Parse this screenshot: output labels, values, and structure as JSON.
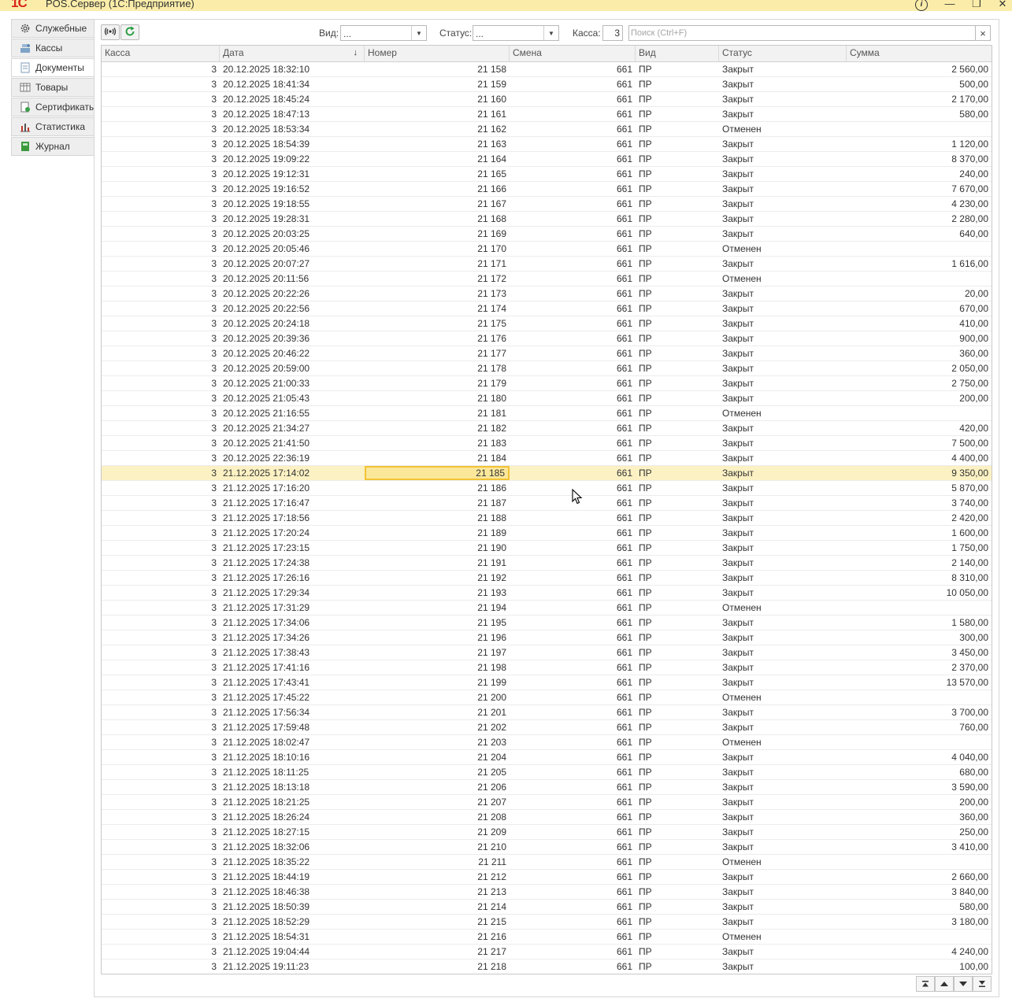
{
  "window": {
    "logo": "1С",
    "title": "POS.Сервер  (1С:Предприятие)",
    "info_glyph": "i",
    "minimize_glyph": "—",
    "maximize_glyph": "❐",
    "close_glyph": "✕"
  },
  "sidebar": {
    "items": [
      {
        "label": "Служебные",
        "icon": "gear-icon"
      },
      {
        "label": "Кассы",
        "icon": "cash-register-icon"
      },
      {
        "label": "Документы",
        "icon": "document-icon",
        "active": true
      },
      {
        "label": "Товары",
        "icon": "table-icon"
      },
      {
        "label": "Сертификаты",
        "icon": "certificate-icon"
      },
      {
        "label": "Статистика",
        "icon": "chart-icon"
      },
      {
        "label": "Журнал",
        "icon": "journal-icon"
      }
    ]
  },
  "toolbar": {
    "vid_label": "Вид:",
    "vid_value": "...",
    "status_label": "Статус:",
    "status_value": "...",
    "kassa_label": "Касса:",
    "kassa_value": "3",
    "search_placeholder": "Поиск (Ctrl+F)",
    "clear_glyph": "×"
  },
  "table": {
    "columns": [
      "Касса",
      "Дата",
      "Номер",
      "Смена",
      "Вид",
      "Статус",
      "Сумма"
    ],
    "sort_indicator": "↓",
    "selected_index": 27,
    "rows": [
      [
        "3",
        "20.12.2025 18:32:10",
        "21 158",
        "661",
        "ПР",
        "Закрыт",
        "2 560,00"
      ],
      [
        "3",
        "20.12.2025 18:41:34",
        "21 159",
        "661",
        "ПР",
        "Закрыт",
        "500,00"
      ],
      [
        "3",
        "20.12.2025 18:45:24",
        "21 160",
        "661",
        "ПР",
        "Закрыт",
        "2 170,00"
      ],
      [
        "3",
        "20.12.2025 18:47:13",
        "21 161",
        "661",
        "ПР",
        "Закрыт",
        "580,00"
      ],
      [
        "3",
        "20.12.2025 18:53:34",
        "21 162",
        "661",
        "ПР",
        "Отменен",
        ""
      ],
      [
        "3",
        "20.12.2025 18:54:39",
        "21 163",
        "661",
        "ПР",
        "Закрыт",
        "1 120,00"
      ],
      [
        "3",
        "20.12.2025 19:09:22",
        "21 164",
        "661",
        "ПР",
        "Закрыт",
        "8 370,00"
      ],
      [
        "3",
        "20.12.2025 19:12:31",
        "21 165",
        "661",
        "ПР",
        "Закрыт",
        "240,00"
      ],
      [
        "3",
        "20.12.2025 19:16:52",
        "21 166",
        "661",
        "ПР",
        "Закрыт",
        "7 670,00"
      ],
      [
        "3",
        "20.12.2025 19:18:55",
        "21 167",
        "661",
        "ПР",
        "Закрыт",
        "4 230,00"
      ],
      [
        "3",
        "20.12.2025 19:28:31",
        "21 168",
        "661",
        "ПР",
        "Закрыт",
        "2 280,00"
      ],
      [
        "3",
        "20.12.2025 20:03:25",
        "21 169",
        "661",
        "ПР",
        "Закрыт",
        "640,00"
      ],
      [
        "3",
        "20.12.2025 20:05:46",
        "21 170",
        "661",
        "ПР",
        "Отменен",
        ""
      ],
      [
        "3",
        "20.12.2025 20:07:27",
        "21 171",
        "661",
        "ПР",
        "Закрыт",
        "1 616,00"
      ],
      [
        "3",
        "20.12.2025 20:11:56",
        "21 172",
        "661",
        "ПР",
        "Отменен",
        ""
      ],
      [
        "3",
        "20.12.2025 20:22:26",
        "21 173",
        "661",
        "ПР",
        "Закрыт",
        "20,00"
      ],
      [
        "3",
        "20.12.2025 20:22:56",
        "21 174",
        "661",
        "ПР",
        "Закрыт",
        "670,00"
      ],
      [
        "3",
        "20.12.2025 20:24:18",
        "21 175",
        "661",
        "ПР",
        "Закрыт",
        "410,00"
      ],
      [
        "3",
        "20.12.2025 20:39:36",
        "21 176",
        "661",
        "ПР",
        "Закрыт",
        "900,00"
      ],
      [
        "3",
        "20.12.2025 20:46:22",
        "21 177",
        "661",
        "ПР",
        "Закрыт",
        "360,00"
      ],
      [
        "3",
        "20.12.2025 20:59:00",
        "21 178",
        "661",
        "ПР",
        "Закрыт",
        "2 050,00"
      ],
      [
        "3",
        "20.12.2025 21:00:33",
        "21 179",
        "661",
        "ПР",
        "Закрыт",
        "2 750,00"
      ],
      [
        "3",
        "20.12.2025 21:05:43",
        "21 180",
        "661",
        "ПР",
        "Закрыт",
        "200,00"
      ],
      [
        "3",
        "20.12.2025 21:16:55",
        "21 181",
        "661",
        "ПР",
        "Отменен",
        ""
      ],
      [
        "3",
        "20.12.2025 21:34:27",
        "21 182",
        "661",
        "ПР",
        "Закрыт",
        "420,00"
      ],
      [
        "3",
        "20.12.2025 21:41:50",
        "21 183",
        "661",
        "ПР",
        "Закрыт",
        "7 500,00"
      ],
      [
        "3",
        "20.12.2025 22:36:19",
        "21 184",
        "661",
        "ПР",
        "Закрыт",
        "4 400,00"
      ],
      [
        "3",
        "21.12.2025 17:14:02",
        "21 185",
        "661",
        "ПР",
        "Закрыт",
        "9 350,00"
      ],
      [
        "3",
        "21.12.2025 17:16:20",
        "21 186",
        "661",
        "ПР",
        "Закрыт",
        "5 870,00"
      ],
      [
        "3",
        "21.12.2025 17:16:47",
        "21 187",
        "661",
        "ПР",
        "Закрыт",
        "3 740,00"
      ],
      [
        "3",
        "21.12.2025 17:18:56",
        "21 188",
        "661",
        "ПР",
        "Закрыт",
        "2 420,00"
      ],
      [
        "3",
        "21.12.2025 17:20:24",
        "21 189",
        "661",
        "ПР",
        "Закрыт",
        "1 600,00"
      ],
      [
        "3",
        "21.12.2025 17:23:15",
        "21 190",
        "661",
        "ПР",
        "Закрыт",
        "1 750,00"
      ],
      [
        "3",
        "21.12.2025 17:24:38",
        "21 191",
        "661",
        "ПР",
        "Закрыт",
        "2 140,00"
      ],
      [
        "3",
        "21.12.2025 17:26:16",
        "21 192",
        "661",
        "ПР",
        "Закрыт",
        "8 310,00"
      ],
      [
        "3",
        "21.12.2025 17:29:34",
        "21 193",
        "661",
        "ПР",
        "Закрыт",
        "10 050,00"
      ],
      [
        "3",
        "21.12.2025 17:31:29",
        "21 194",
        "661",
        "ПР",
        "Отменен",
        ""
      ],
      [
        "3",
        "21.12.2025 17:34:06",
        "21 195",
        "661",
        "ПР",
        "Закрыт",
        "1 580,00"
      ],
      [
        "3",
        "21.12.2025 17:34:26",
        "21 196",
        "661",
        "ПР",
        "Закрыт",
        "300,00"
      ],
      [
        "3",
        "21.12.2025 17:38:43",
        "21 197",
        "661",
        "ПР",
        "Закрыт",
        "3 450,00"
      ],
      [
        "3",
        "21.12.2025 17:41:16",
        "21 198",
        "661",
        "ПР",
        "Закрыт",
        "2 370,00"
      ],
      [
        "3",
        "21.12.2025 17:43:41",
        "21 199",
        "661",
        "ПР",
        "Закрыт",
        "13 570,00"
      ],
      [
        "3",
        "21.12.2025 17:45:22",
        "21 200",
        "661",
        "ПР",
        "Отменен",
        ""
      ],
      [
        "3",
        "21.12.2025 17:56:34",
        "21 201",
        "661",
        "ПР",
        "Закрыт",
        "3 700,00"
      ],
      [
        "3",
        "21.12.2025 17:59:48",
        "21 202",
        "661",
        "ПР",
        "Закрыт",
        "760,00"
      ],
      [
        "3",
        "21.12.2025 18:02:47",
        "21 203",
        "661",
        "ПР",
        "Отменен",
        ""
      ],
      [
        "3",
        "21.12.2025 18:10:16",
        "21 204",
        "661",
        "ПР",
        "Закрыт",
        "4 040,00"
      ],
      [
        "3",
        "21.12.2025 18:11:25",
        "21 205",
        "661",
        "ПР",
        "Закрыт",
        "680,00"
      ],
      [
        "3",
        "21.12.2025 18:13:18",
        "21 206",
        "661",
        "ПР",
        "Закрыт",
        "3 590,00"
      ],
      [
        "3",
        "21.12.2025 18:21:25",
        "21 207",
        "661",
        "ПР",
        "Закрыт",
        "200,00"
      ],
      [
        "3",
        "21.12.2025 18:26:24",
        "21 208",
        "661",
        "ПР",
        "Закрыт",
        "360,00"
      ],
      [
        "3",
        "21.12.2025 18:27:15",
        "21 209",
        "661",
        "ПР",
        "Закрыт",
        "250,00"
      ],
      [
        "3",
        "21.12.2025 18:32:06",
        "21 210",
        "661",
        "ПР",
        "Закрыт",
        "3 410,00"
      ],
      [
        "3",
        "21.12.2025 18:35:22",
        "21 211",
        "661",
        "ПР",
        "Отменен",
        ""
      ],
      [
        "3",
        "21.12.2025 18:44:19",
        "21 212",
        "661",
        "ПР",
        "Закрыт",
        "2 660,00"
      ],
      [
        "3",
        "21.12.2025 18:46:38",
        "21 213",
        "661",
        "ПР",
        "Закрыт",
        "3 840,00"
      ],
      [
        "3",
        "21.12.2025 18:50:39",
        "21 214",
        "661",
        "ПР",
        "Закрыт",
        "580,00"
      ],
      [
        "3",
        "21.12.2025 18:52:29",
        "21 215",
        "661",
        "ПР",
        "Закрыт",
        "3 180,00"
      ],
      [
        "3",
        "21.12.2025 18:54:31",
        "21 216",
        "661",
        "ПР",
        "Отменен",
        ""
      ],
      [
        "3",
        "21.12.2025 19:04:44",
        "21 217",
        "661",
        "ПР",
        "Закрыт",
        "4 240,00"
      ],
      [
        "3",
        "21.12.2025 19:11:23",
        "21 218",
        "661",
        "ПР",
        "Закрыт",
        "100,00"
      ]
    ]
  },
  "colors": {
    "titlebar": "#fbeda9",
    "selected_row": "#fcf1c3",
    "focused_cell_border": "#f2c336",
    "refresh_icon": "#1f9a3a"
  }
}
